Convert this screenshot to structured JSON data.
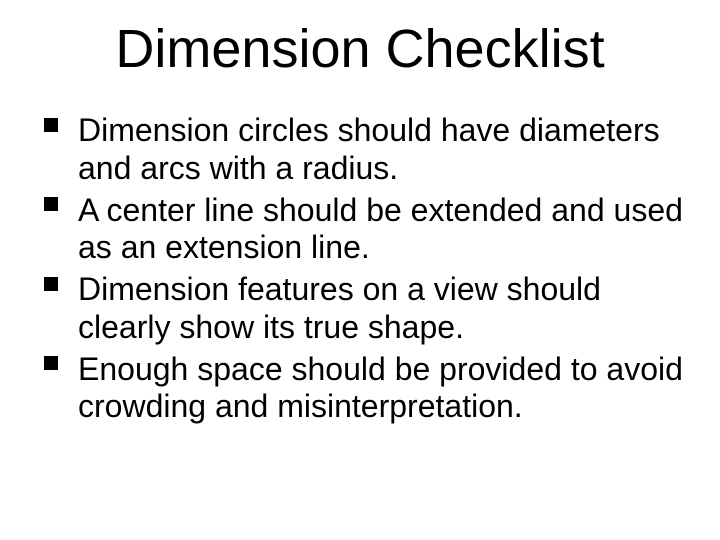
{
  "title": "Dimension Checklist",
  "bullets": [
    "Dimension circles should have diameters and arcs with a radius.",
    "A center line should be extended and used as an extension line.",
    "Dimension features on a view should clearly show its true shape.",
    "Enough space should be provided to avoid crowding and misinterpretation."
  ]
}
